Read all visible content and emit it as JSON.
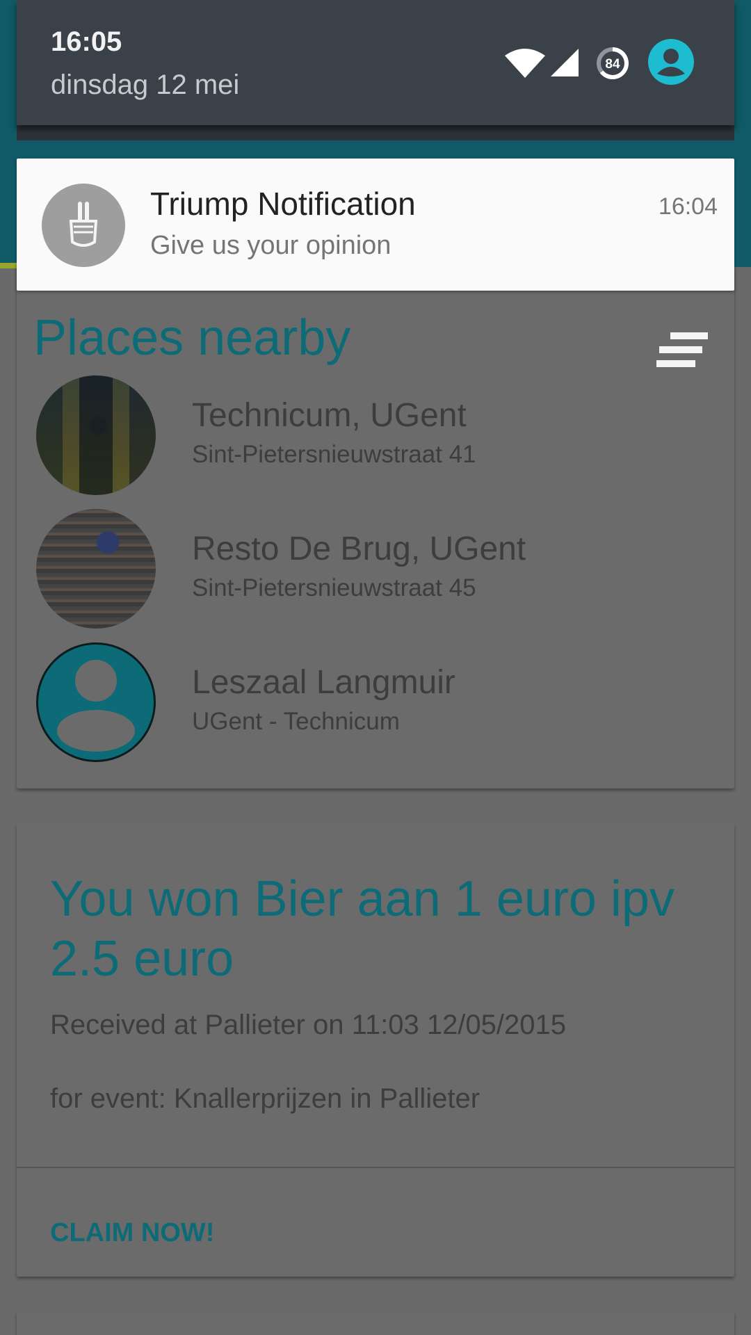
{
  "status": {
    "time": "16:05",
    "date": "dinsdag 12 mei",
    "battery_level": "84"
  },
  "notification": {
    "title": "Triump Notification",
    "text": "Give us your opinion",
    "time": "16:04"
  },
  "places": {
    "title": "Places nearby",
    "items": [
      {
        "name": "Technicum, UGent",
        "address": "Sint-Pietersnieuwstraat 41"
      },
      {
        "name": "Resto De Brug, UGent",
        "address": "Sint-Pietersnieuwstraat 45"
      },
      {
        "name": "Leszaal Langmuir",
        "address": "UGent - Technicum"
      }
    ]
  },
  "prize": {
    "title": "You won Bier aan 1 euro ipv 2.5 euro",
    "received": "Received at Pallieter on 11:03 12/05/2015",
    "event": "for event: Knallerprijzen in Pallieter",
    "claim_label": "CLAIM NOW!"
  },
  "colors": {
    "accent": "#0d6b77",
    "shade_header": "#3a4149",
    "notification_bg": "#fafafa",
    "scrim": "#6a6a6a",
    "user_icon": "#1ebcd0"
  },
  "icons": {
    "wifi": "wifi-icon",
    "signal": "signal-icon",
    "battery": "battery-icon",
    "user": "user-icon",
    "sort": "sort-icon",
    "app": "hand-icon"
  }
}
